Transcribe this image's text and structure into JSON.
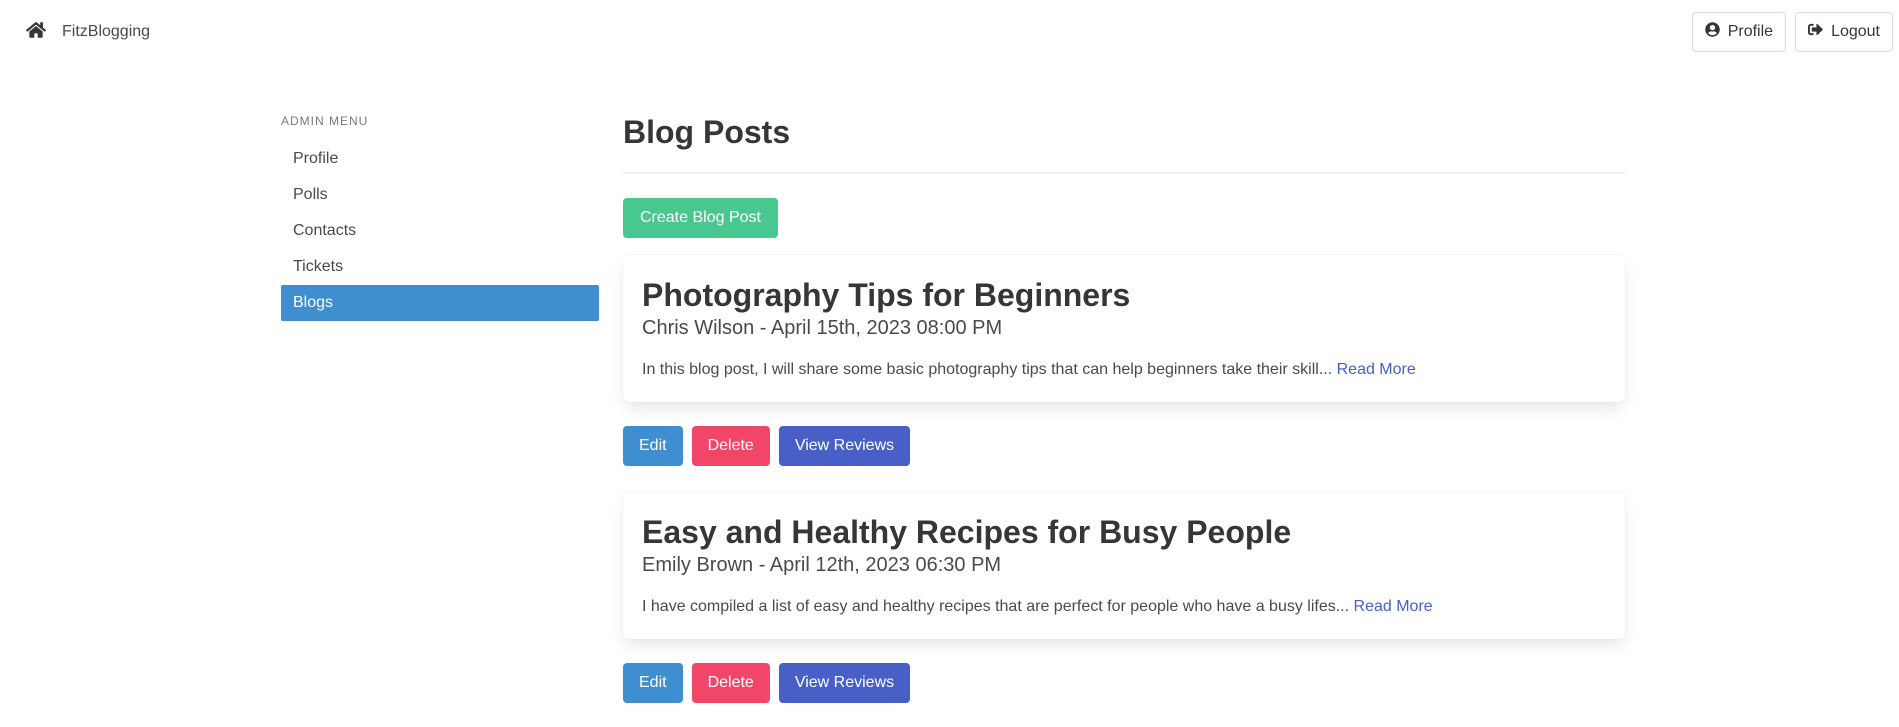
{
  "navbar": {
    "brand": "FitzBlogging",
    "profile_label": "Profile",
    "logout_label": "Logout"
  },
  "sidebar": {
    "menu_label": "ADMIN MENU",
    "items": [
      {
        "label": "Profile",
        "active": false
      },
      {
        "label": "Polls",
        "active": false
      },
      {
        "label": "Contacts",
        "active": false
      },
      {
        "label": "Tickets",
        "active": false
      },
      {
        "label": "Blogs",
        "active": true
      }
    ]
  },
  "main": {
    "title": "Blog Posts",
    "create_label": "Create Blog Post",
    "posts": [
      {
        "title": "Photography Tips for Beginners",
        "meta": "Chris Wilson - April 15th, 2023 08:00 PM",
        "excerpt": "In this blog post, I will share some basic photography tips that can help beginners take their skill...",
        "read_more": "Read More",
        "edit_label": "Edit",
        "delete_label": "Delete",
        "reviews_label": "View Reviews"
      },
      {
        "title": "Easy and Healthy Recipes for Busy People",
        "meta": "Emily Brown - April 12th, 2023 06:30 PM",
        "excerpt": "I have compiled a list of easy and healthy recipes that are perfect for people who have a busy lifes...",
        "read_more": "Read More",
        "edit_label": "Edit",
        "delete_label": "Delete",
        "reviews_label": "View Reviews"
      }
    ]
  },
  "colors": {
    "primary": "#3e8ed0",
    "success": "#48c78e",
    "danger": "#f14668",
    "link": "#485fc7"
  }
}
